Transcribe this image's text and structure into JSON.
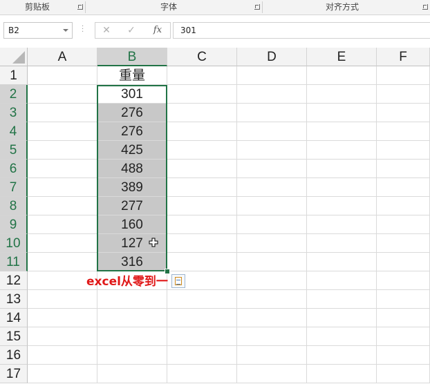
{
  "ribbon": {
    "groups": [
      {
        "label": "剪贴板"
      },
      {
        "label": "字体"
      },
      {
        "label": "对齐方式"
      }
    ]
  },
  "formula_bar": {
    "name_box": "B2",
    "cancel_symbol": "✕",
    "enter_symbol": "✓",
    "fx_label": "fx",
    "value": "301"
  },
  "sheet": {
    "columns": [
      "A",
      "B",
      "C",
      "D",
      "E",
      "F"
    ],
    "selected_column": "B",
    "rows": [
      "1",
      "2",
      "3",
      "4",
      "5",
      "6",
      "7",
      "8",
      "9",
      "10",
      "11",
      "12",
      "13",
      "14",
      "15",
      "16",
      "17"
    ],
    "selected_rows": [
      "2",
      "3",
      "4",
      "5",
      "6",
      "7",
      "8",
      "9",
      "10",
      "11"
    ],
    "column_b": [
      "重量",
      "301",
      "276",
      "276",
      "425",
      "488",
      "389",
      "277",
      "160",
      "127",
      "316"
    ],
    "watermark": "excel从零到一",
    "accent_color": "#217346",
    "watermark_color": "#e01818"
  },
  "icons": {
    "quick_analysis": "quick-analysis-icon",
    "cursor": "cross-cursor-icon"
  }
}
